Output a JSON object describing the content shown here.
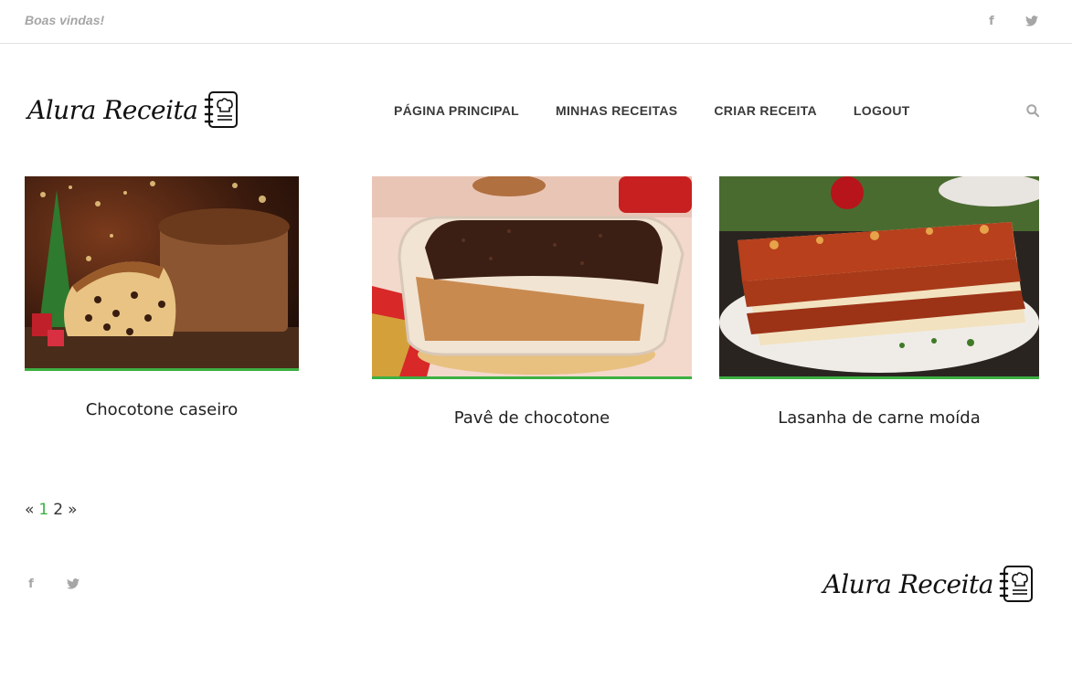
{
  "topbar": {
    "welcome": "Boas vindas!",
    "social": [
      "facebook-icon",
      "twitter-icon"
    ]
  },
  "header": {
    "logo_text": "Alura Receita",
    "nav": [
      {
        "label": "PÁGINA PRINCIPAL"
      },
      {
        "label": "MINHAS RECEITAS"
      },
      {
        "label": "CRIAR RECEITA"
      },
      {
        "label": "LOGOUT"
      }
    ],
    "search_icon": "search-icon"
  },
  "recipes": [
    {
      "title": "Chocotone caseiro",
      "image": "panettone-photo"
    },
    {
      "title": "Pavê de chocotone",
      "image": "pave-dessert-photo"
    },
    {
      "title": "Lasanha de carne moída",
      "image": "lasagna-photo"
    }
  ],
  "pagination": {
    "prev": "«",
    "pages": [
      "1",
      "2"
    ],
    "current": "1",
    "next": "»"
  },
  "footer": {
    "logo_text": "Alura Receita",
    "social": [
      "facebook-icon",
      "twitter-icon"
    ]
  },
  "colors": {
    "accent": "#3cb043",
    "muted": "#a6a6a6",
    "nav_text": "#3a3a3a"
  }
}
